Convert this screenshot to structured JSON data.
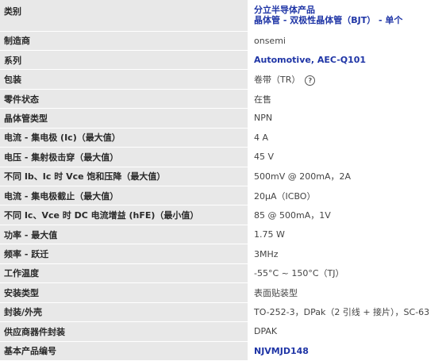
{
  "rows": [
    {
      "label": "类别",
      "line1": "分立半导体产品",
      "line2": "晶体管 - 双极性晶体管（BJT） - 单个"
    },
    {
      "label": "制造商",
      "value": "onsemi"
    },
    {
      "label": "系列",
      "value": "Automotive, AEC-Q101"
    },
    {
      "label": "包装",
      "value": "卷带（TR）"
    },
    {
      "label": "零件状态",
      "value": "在售"
    },
    {
      "label": "晶体管类型",
      "value": "NPN"
    },
    {
      "label": "电流 - 集电极 (Ic)（最大值）",
      "value": "4 A"
    },
    {
      "label": "电压 - 集射极击穿（最大值）",
      "value": "45 V"
    },
    {
      "label": "不同 Ib、Ic 时 Vce 饱和压降（最大值）",
      "value": "500mV @ 200mA，2A"
    },
    {
      "label": "电流 - 集电极截止（最大值）",
      "value": "20µA（ICBO）"
    },
    {
      "label": "不同 Ic、Vce 时 DC 电流增益 (hFE)（最小值）",
      "value": "85 @ 500mA，1V"
    },
    {
      "label": "功率 - 最大值",
      "value": "1.75 W"
    },
    {
      "label": "频率 - 跃迁",
      "value": "3MHz"
    },
    {
      "label": "工作温度",
      "value": "-55°C ~ 150°C（TJ）"
    },
    {
      "label": "安装类型",
      "value": "表面贴装型"
    },
    {
      "label": "封装/外壳",
      "value": "TO-252-3，DPak（2 引线 + 接片），SC-63"
    },
    {
      "label": "供应商器件封装",
      "value": "DPAK"
    },
    {
      "label": "基本产品编号",
      "value": "NJVMJD148"
    }
  ],
  "help_icon_glyph": "?"
}
